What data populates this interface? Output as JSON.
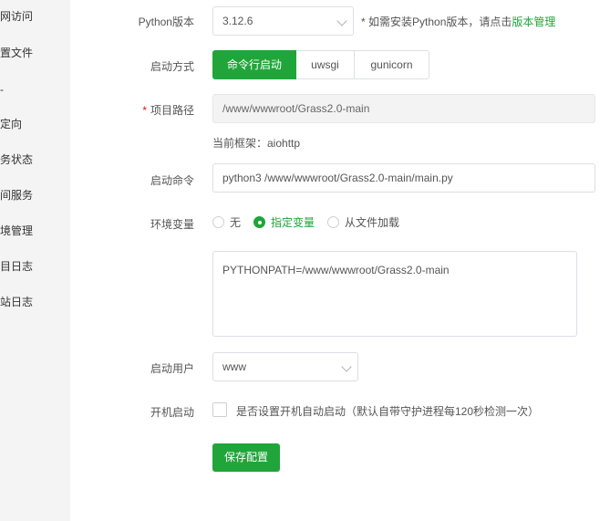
{
  "sidebar": {
    "items": [
      {
        "label": "网访问"
      },
      {
        "label": "置文件"
      },
      {
        "label": "-"
      },
      {
        "label": "定向"
      },
      {
        "label": "务状态"
      },
      {
        "label": "间服务"
      },
      {
        "label": "境管理"
      },
      {
        "label": "目日志"
      },
      {
        "label": "站日志"
      }
    ]
  },
  "form": {
    "python_version": {
      "label": "Python版本",
      "value": "3.12.6",
      "hint_prefix": "* 如需安装Python版本，请点击",
      "hint_link": "版本管理"
    },
    "start_mode": {
      "label": "启动方式",
      "options": [
        "命令行启动",
        "uwsgi",
        "gunicorn"
      ],
      "selected": "命令行启动"
    },
    "project_path": {
      "required_mark": "*",
      "label": "项目路径",
      "value": "/www/wwwroot/Grass2.0-main",
      "framework_text": "当前框架：aiohttp"
    },
    "start_command": {
      "label": "启动命令",
      "value": "python3 /www/wwwroot/Grass2.0-main/main.py"
    },
    "env_vars": {
      "label": "环境变量",
      "options": [
        "无",
        "指定变量",
        "从文件加载"
      ],
      "selected": "指定变量",
      "value": "PYTHONPATH=/www/wwwroot/Grass2.0-main"
    },
    "start_user": {
      "label": "启动用户",
      "value": "www"
    },
    "autostart": {
      "label": "开机启动",
      "text": "是否设置开机自动启动（默认自带守护进程每120秒检测一次）",
      "checked": false
    },
    "save_label": "保存配置"
  },
  "colors": {
    "accent": "#20a53a",
    "required": "#ef0808",
    "sidebar_bg": "#f4f4f4"
  }
}
